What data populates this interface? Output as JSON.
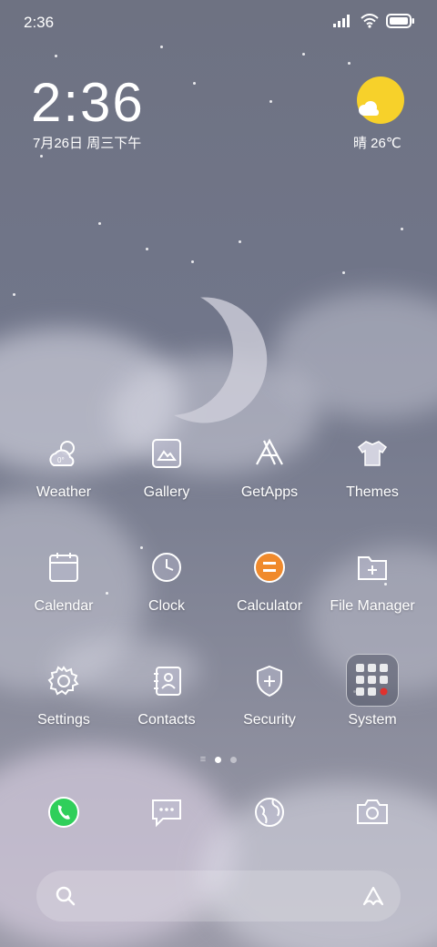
{
  "status_bar": {
    "time": "2:36"
  },
  "clock_widget": {
    "time": "2:36",
    "date": "7月26日 周三下午"
  },
  "weather_widget": {
    "text": "晴 26℃"
  },
  "apps": [
    {
      "label": "Weather",
      "icon": "weather-icon"
    },
    {
      "label": "Gallery",
      "icon": "gallery-icon"
    },
    {
      "label": "GetApps",
      "icon": "getapps-icon"
    },
    {
      "label": "Themes",
      "icon": "themes-icon"
    },
    {
      "label": "Calendar",
      "icon": "calendar-icon"
    },
    {
      "label": "Clock",
      "icon": "clock-icon"
    },
    {
      "label": "Calculator",
      "icon": "calculator-icon"
    },
    {
      "label": "File Manager",
      "icon": "folder-icon"
    },
    {
      "label": "Settings",
      "icon": "gear-icon"
    },
    {
      "label": "Contacts",
      "icon": "contacts-icon"
    },
    {
      "label": "Security",
      "icon": "shield-icon"
    },
    {
      "label": "System",
      "icon": "folder-grid-icon"
    }
  ],
  "dock": [
    {
      "icon": "phone-icon"
    },
    {
      "icon": "messages-icon"
    },
    {
      "icon": "browser-icon"
    },
    {
      "icon": "camera-icon"
    }
  ],
  "colors": {
    "calculator_orange": "#f08a2c",
    "phone_green": "#2fcf5a",
    "sun_yellow": "#f7d12a"
  }
}
